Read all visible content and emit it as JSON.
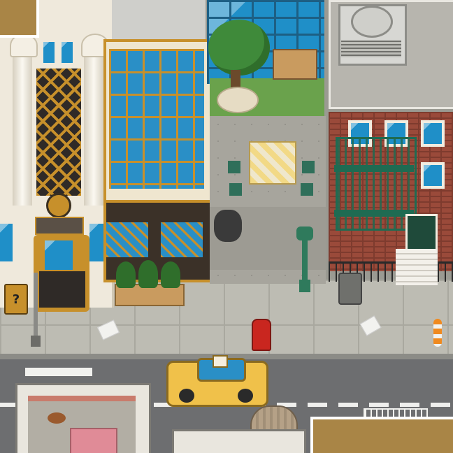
{
  "scene": {
    "sign_text": "",
    "question_mark": "?",
    "hydrant_color": "#c9261f",
    "taxi_color": "#f0c14a",
    "taxi_top_light": "",
    "road_color": "#6d6e70",
    "sidewalk_color": "#bdbcb3",
    "accent": "#a98546"
  }
}
